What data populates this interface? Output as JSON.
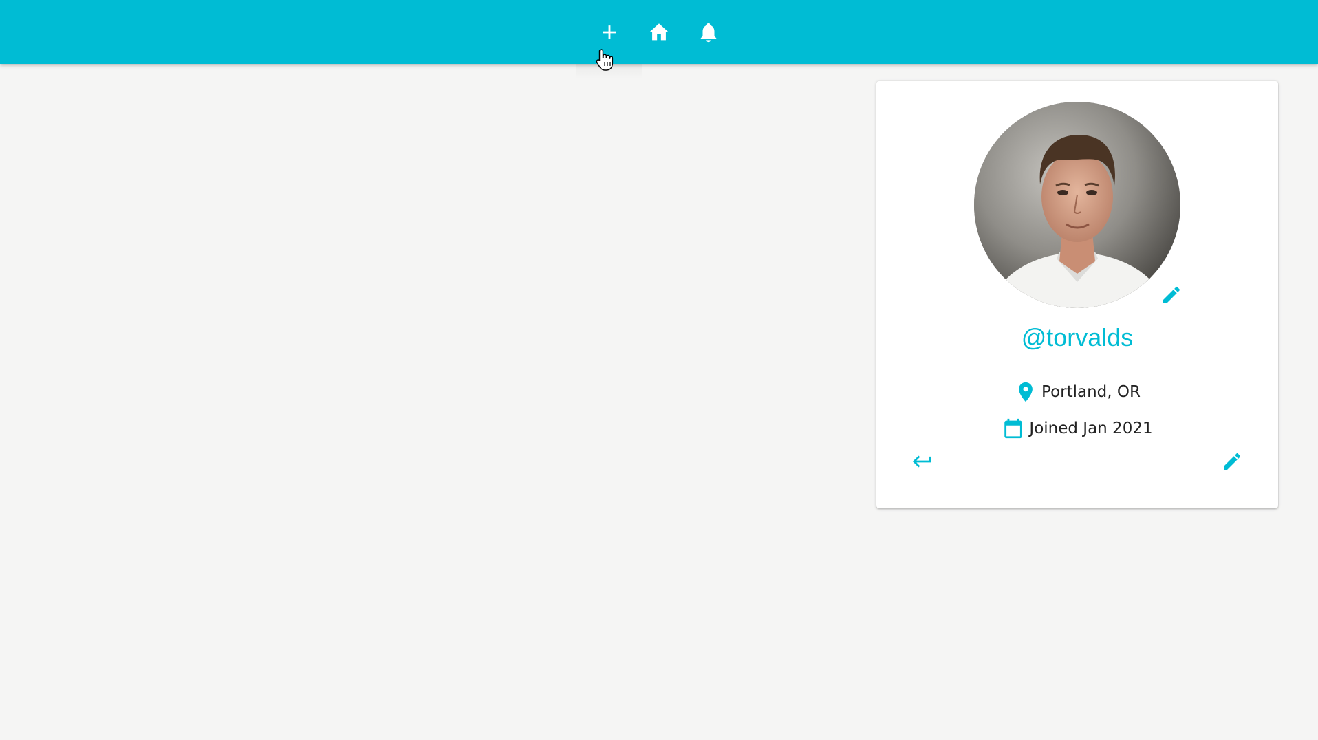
{
  "navbar": {
    "color": "#00bcd4",
    "items": [
      {
        "icon": "add-icon"
      },
      {
        "icon": "home-icon"
      },
      {
        "icon": "bell-icon"
      }
    ]
  },
  "profile": {
    "handle": "@torvalds",
    "location": "Portland, OR",
    "joined": "Joined Jan 2021",
    "accent_color": "#00bcd4",
    "icons": {
      "location": "location-pin-icon",
      "joined": "calendar-icon",
      "logout": "return-arrow-icon",
      "edit": "pencil-icon",
      "edit_photo": "pencil-icon"
    }
  }
}
